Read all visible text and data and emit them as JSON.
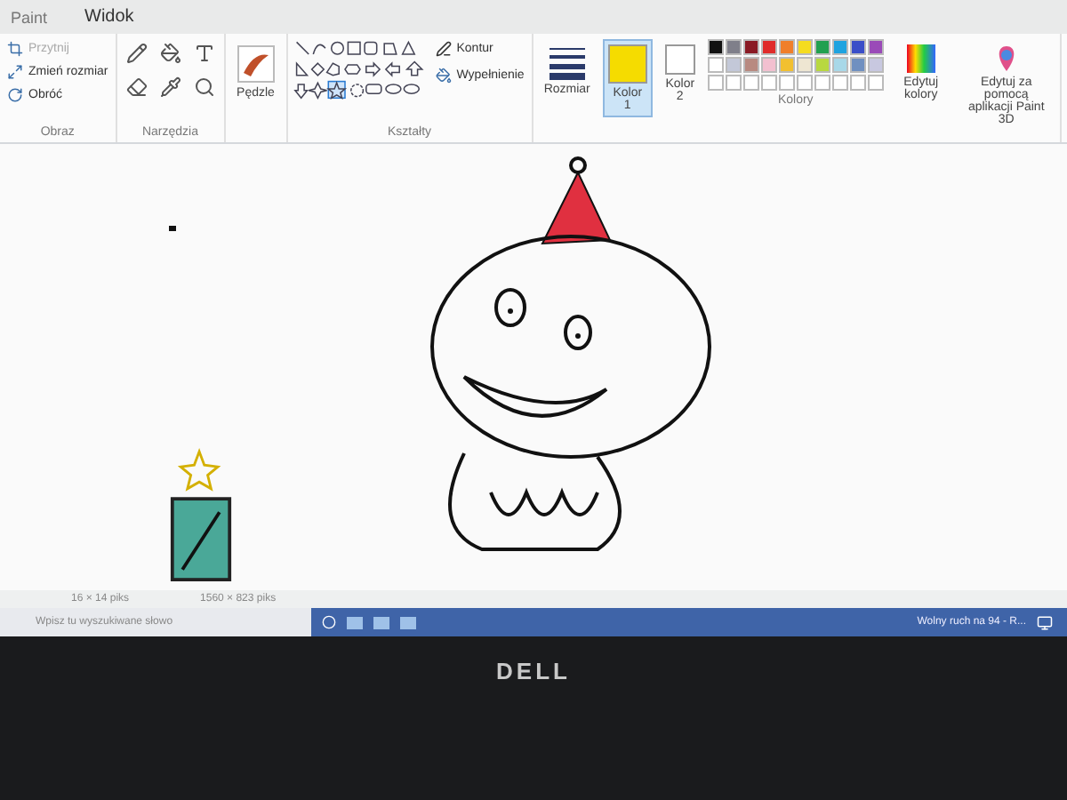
{
  "window": {
    "title": "Paint"
  },
  "tabs": [
    {
      "label": "Widok",
      "selected": false
    }
  ],
  "image_group": {
    "label": "Obraz",
    "items": [
      {
        "label": "Przytnij",
        "disabled": true
      },
      {
        "label": "Zmień rozmiar",
        "disabled": false
      },
      {
        "label": "Obróć",
        "disabled": false
      }
    ]
  },
  "tools_group": {
    "label": "Narzędzia"
  },
  "brushes": {
    "label": "Pędzle"
  },
  "shapes_group": {
    "label": "Kształty",
    "outline": "Kontur",
    "fill": "Wypełnienie"
  },
  "size": {
    "label": "Rozmiar"
  },
  "color_slots": [
    {
      "label": "Kolor",
      "number": "1",
      "color": "#f5dc00",
      "selected": true
    },
    {
      "label": "Kolor",
      "number": "2",
      "color": "#ffffff",
      "selected": false
    }
  ],
  "palette": [
    {
      "color": "#111111"
    },
    {
      "color": "#7f7f8a"
    },
    {
      "color": "#8a1a24"
    },
    {
      "color": "#e02b2b"
    },
    {
      "color": "#f07f2a"
    },
    {
      "color": "#f5dc20"
    },
    {
      "color": "#22a050"
    },
    {
      "color": "#1fa3e0"
    },
    {
      "color": "#3a4ec8"
    },
    {
      "color": "#9a4ab8"
    },
    {
      "color": "#ffffff"
    },
    {
      "color": "#c3c8d8"
    },
    {
      "color": "#b88a80"
    },
    {
      "color": "#f2c0d0"
    },
    {
      "color": "#f2c030"
    },
    {
      "color": "#eee6d2"
    },
    {
      "color": "#b8d840"
    },
    {
      "color": "#a8d8e8"
    },
    {
      "color": "#7090c0"
    },
    {
      "color": "#c8c8e0"
    }
  ],
  "edit_colors": "Edytuj kolory",
  "paint3d": "Edytuj za pomocą aplikacji Paint 3D",
  "colors_group": {
    "label": "Kolory"
  },
  "status_bar": {
    "selection": "16 × 14 piks",
    "canvas_size": "1560 × 823 piks"
  },
  "taskbar": {
    "search": {
      "placeholder": "Wpisz tu wyszukiwane słowo"
    },
    "notification": "Wolny ruch na 94 - R..."
  },
  "bezel": {
    "logo": "DELL"
  }
}
